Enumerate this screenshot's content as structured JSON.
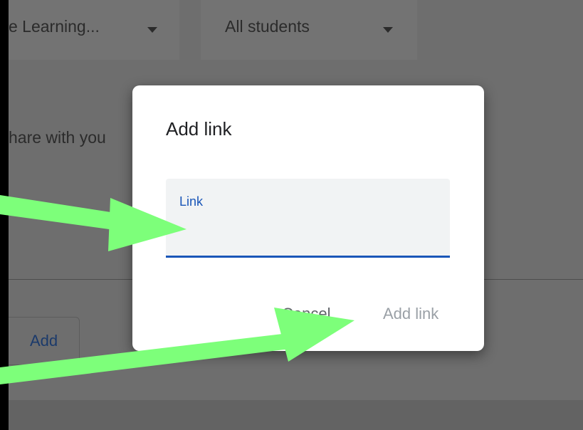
{
  "background": {
    "class_select": {
      "label": "e Learning..."
    },
    "students_select": {
      "label": "All students"
    },
    "share_text": "hare with you",
    "add_button": {
      "label": "Add"
    }
  },
  "dialog": {
    "title": "Add link",
    "link_field": {
      "label": "Link",
      "value": ""
    },
    "cancel_label": "Cancel",
    "add_link_label": "Add link"
  },
  "colors": {
    "accent": "#1a56b8",
    "annotation_arrow": "#7dff7a",
    "overlay": "#6e6e6e"
  }
}
